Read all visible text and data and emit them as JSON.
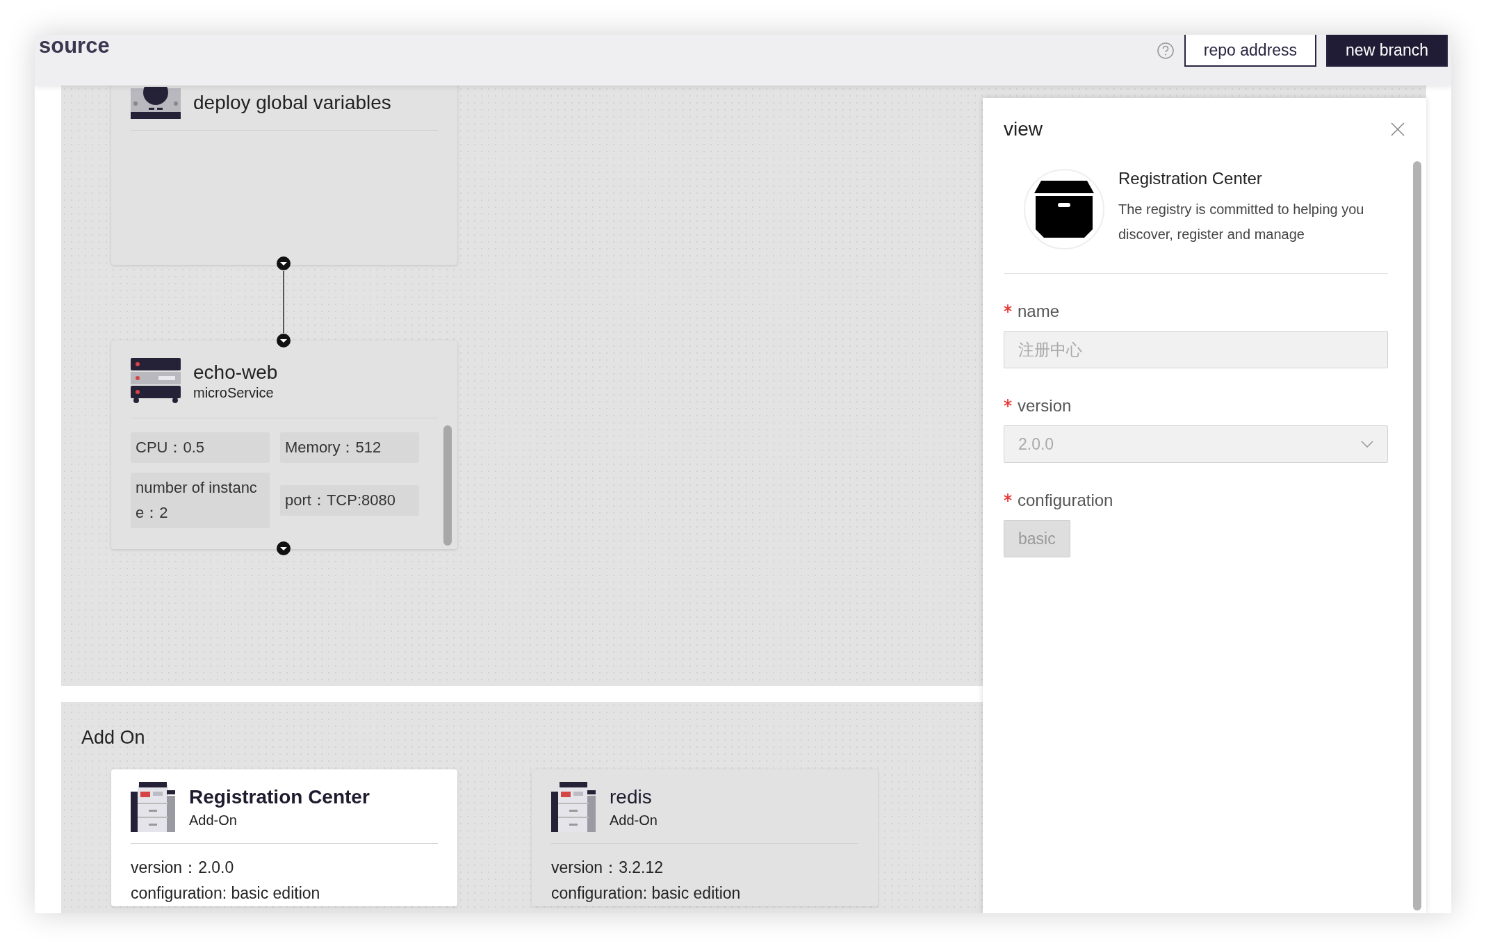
{
  "header": {
    "title": "source",
    "buttons": [
      {
        "label": "repo address",
        "kind": "outline"
      },
      {
        "label": "new branch",
        "kind": "primary"
      }
    ]
  },
  "canvas": {
    "nodes": [
      {
        "kind": "globals",
        "title": "deploy global variables"
      },
      {
        "kind": "service",
        "title": "echo-web",
        "subtitle": "microService",
        "specs": [
          "CPU：0.5",
          "Memory：512",
          "number of instance：2",
          "port：TCP:8080"
        ]
      }
    ]
  },
  "addon": {
    "title": "Add On",
    "cards": [
      {
        "name": "Registration Center",
        "tag": "Add-On",
        "version": "version：2.0.0",
        "configuration": "configuration: basic edition",
        "selected": true
      },
      {
        "name": "redis",
        "tag": "Add-On",
        "version": "version：3.2.12",
        "configuration": "configuration: basic edition",
        "selected": false
      }
    ]
  },
  "drawer": {
    "title": "view",
    "addon": {
      "name": "Registration Center",
      "description": "The registry is committed to helping you discover, register and manage"
    },
    "fields": [
      {
        "kind": "input",
        "label": "name",
        "value": "注册中心",
        "required": true,
        "disabled": true
      },
      {
        "kind": "select",
        "label": "version",
        "value": "2.0.0",
        "required": true,
        "disabled": true
      },
      {
        "kind": "button",
        "label": "configuration",
        "value": "basic",
        "required": true,
        "disabled": true
      }
    ]
  }
}
